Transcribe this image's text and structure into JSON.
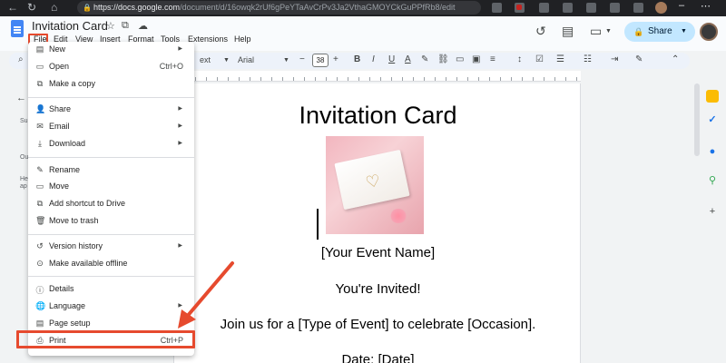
{
  "browser": {
    "url_host": "https://docs.google.com",
    "url_path": "/document/d/16owqk2rUf6gPeYTaAvCrPv3Ja2VthaGMOYCkGuPPfRb8/edit"
  },
  "doc": {
    "title": "Invitation Card"
  },
  "menubar": {
    "file": "File",
    "edit": "Edit",
    "view": "View",
    "insert": "Insert",
    "format": "Format",
    "tools": "Tools",
    "extensions": "Extensions",
    "help": "Help"
  },
  "share_label": "Share",
  "toolbar": {
    "style": "ext",
    "font": "Arial",
    "font_size": "38"
  },
  "file_menu": {
    "new": "New",
    "open": "Open",
    "open_shortcut": "Ctrl+O",
    "make_copy": "Make a copy",
    "share": "Share",
    "email": "Email",
    "download": "Download",
    "rename": "Rename",
    "move": "Move",
    "add_shortcut": "Add shortcut to Drive",
    "move_trash": "Move to trash",
    "version_history": "Version history",
    "make_offline": "Make available offline",
    "details": "Details",
    "language": "Language",
    "page_setup": "Page setup",
    "print": "Print",
    "print_shortcut": "Ctrl+P"
  },
  "document": {
    "heading": "Invitation Card",
    "event_name": "[Your Event Name]",
    "invited": "You're Invited!",
    "join": "Join us for a [Type of Event] to celebrate [Occasion].",
    "date": "Date: [Date]"
  },
  "left_panel": {
    "su": "Su",
    "ou": "Ou",
    "he": "He",
    "ap": "ap"
  },
  "colors": {
    "highlight": "#e64a2e",
    "share_bg": "#c2e7ff",
    "docs_blue": "#4285f4"
  }
}
